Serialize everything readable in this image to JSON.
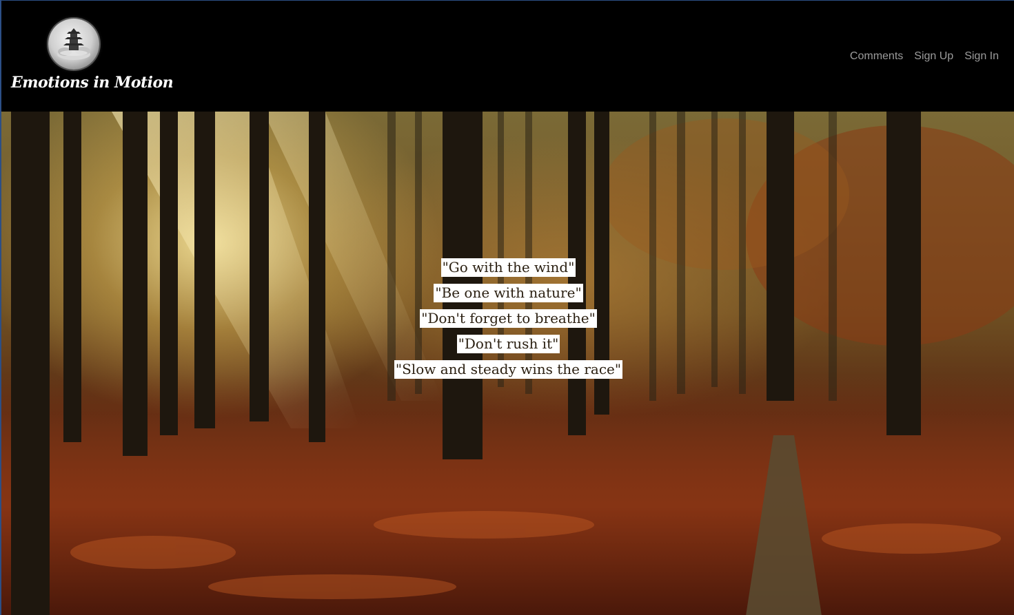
{
  "brand": {
    "name": "Emotions in Motion",
    "logo_icon": "pagoda-logo-icon"
  },
  "nav": {
    "items": [
      {
        "label": "Comments"
      },
      {
        "label": "Sign Up"
      },
      {
        "label": "Sign In"
      }
    ]
  },
  "hero": {
    "background": "autumn-forest-image",
    "quotes": [
      "\"Go with the wind\"",
      "\"Be one with nature\"",
      "\"Don't forget to breathe\"",
      "\"Don't rush it\"",
      "\"Slow and steady wins the race\""
    ]
  },
  "colors": {
    "navbar_bg": "#000000",
    "nav_link": "#9c9c9c",
    "quote_bg": "#ffffff",
    "quote_text": "#2b2012"
  }
}
